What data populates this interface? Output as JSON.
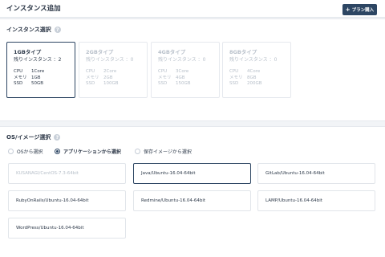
{
  "header": {
    "title": "インスタンス追加",
    "buy_button": "プラン購入",
    "buy_icon": "plus-icon"
  },
  "instance_section": {
    "title": "インスタンス選択",
    "help": "?",
    "cards": [
      {
        "name": "1GBタイプ",
        "remain": "残りインスタンス ：2",
        "cpu": "1Core",
        "mem": "1GB",
        "ssd": "50GB",
        "state": "selected"
      },
      {
        "name": "2GBタイプ",
        "remain": "残りインスタンス ：0",
        "cpu": "2Core",
        "mem": "2GB",
        "ssd": "100GB",
        "state": "disabled"
      },
      {
        "name": "4GBタイプ",
        "remain": "残りインスタンス ：0",
        "cpu": "3Core",
        "mem": "4GB",
        "ssd": "150GB",
        "state": "disabled"
      },
      {
        "name": "8GBタイプ",
        "remain": "残りインスタンス ：0",
        "cpu": "4Core",
        "mem": "8GB",
        "ssd": "200GB",
        "state": "disabled"
      }
    ],
    "spec_labels": {
      "cpu": "CPU",
      "mem": "メモリ",
      "ssd": "SSD"
    }
  },
  "os_section": {
    "title": "OS/イメージ選択",
    "help": "?",
    "radios": [
      {
        "label": "OSから選択",
        "checked": false
      },
      {
        "label": "アプリケーションから選択",
        "checked": true
      },
      {
        "label": "保存イメージから選択",
        "checked": false
      }
    ],
    "images": [
      {
        "label": "KUSANAGI/CentOS-7.3-64bit",
        "state": "disabled"
      },
      {
        "label": "Java/Ubuntu-16.04-64bit",
        "state": "selected"
      },
      {
        "label": "GitLab/Ubuntu-16.04-64bit",
        "state": "normal"
      },
      {
        "label": "RubyOnRails/Ubuntu-16.04-64bit",
        "state": "normal"
      },
      {
        "label": "Redmine/Ubuntu-16.04-64bit",
        "state": "normal"
      },
      {
        "label": "LAMP/Ubuntu-16.04-64bit",
        "state": "normal"
      },
      {
        "label": "WordPress/Ubuntu-16.04-64bit",
        "state": "normal"
      }
    ]
  },
  "colors": {
    "accent": "#2d4663",
    "disabled_text": "#b8c0ca",
    "background": "#f2f4f7"
  }
}
